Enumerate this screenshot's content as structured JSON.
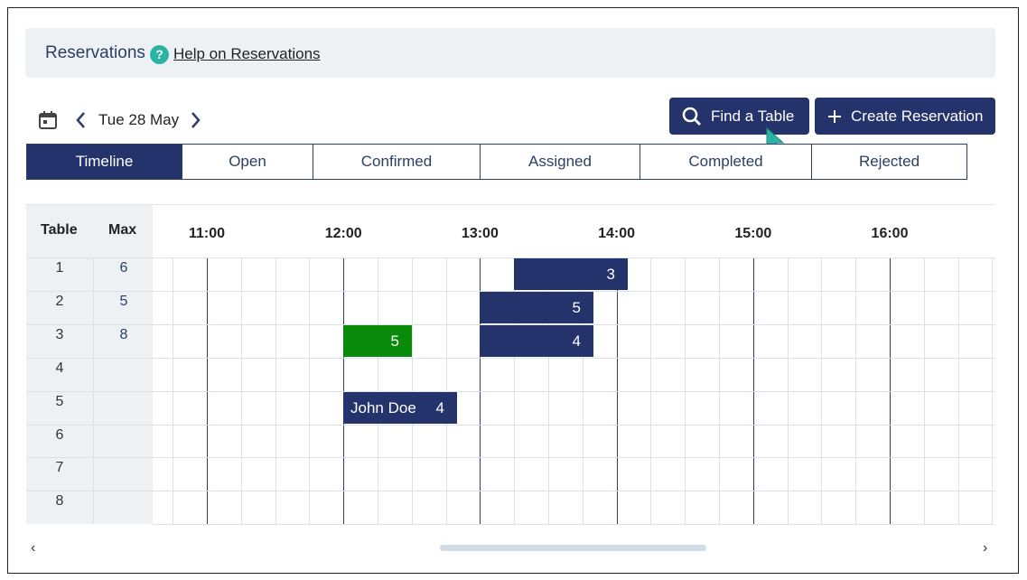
{
  "header": {
    "title": "Reservations",
    "help_icon": "question-circle-icon",
    "help_link": "Help on Reservations"
  },
  "date_nav": {
    "date": "Tue 28 May"
  },
  "buttons": {
    "find_table": "Find a Table",
    "create_reservation": "Create Reservation"
  },
  "tabs": [
    {
      "label": "Timeline",
      "active": true
    },
    {
      "label": "Open"
    },
    {
      "label": "Confirmed"
    },
    {
      "label": "Assigned"
    },
    {
      "label": "Completed"
    },
    {
      "label": "Rejected"
    }
  ],
  "table_columns": {
    "table": "Table",
    "max": "Max"
  },
  "rows": [
    {
      "table": "1",
      "max": "6"
    },
    {
      "table": "2",
      "max": "5"
    },
    {
      "table": "3",
      "max": "8"
    },
    {
      "table": "4",
      "max": ""
    },
    {
      "table": "5",
      "max": ""
    },
    {
      "table": "6",
      "max": ""
    },
    {
      "table": "7",
      "max": ""
    },
    {
      "table": "8",
      "max": ""
    }
  ],
  "times": [
    "11:00",
    "12:00",
    "13:00",
    "14:00",
    "15:00",
    "16:00"
  ],
  "reservations": [
    {
      "table": "1",
      "start": "13:15",
      "end": "14:05",
      "party": "3",
      "name": "",
      "status_color": "#24336b"
    },
    {
      "table": "2",
      "start": "13:00",
      "end": "13:50",
      "party": "5",
      "name": "",
      "status_color": "#24336b"
    },
    {
      "table": "3",
      "start": "12:00",
      "end": "12:30",
      "party": "5",
      "name": "",
      "status_color": "#0a8a0a"
    },
    {
      "table": "3",
      "start": "13:00",
      "end": "13:50",
      "party": "4",
      "name": "",
      "status_color": "#24336b"
    },
    {
      "table": "5",
      "start": "12:00",
      "end": "12:50",
      "party": "4",
      "name": "John Doe",
      "status_color": "#24336b"
    }
  ],
  "scroll": {
    "left_arrow": "‹",
    "right_arrow": "›"
  }
}
